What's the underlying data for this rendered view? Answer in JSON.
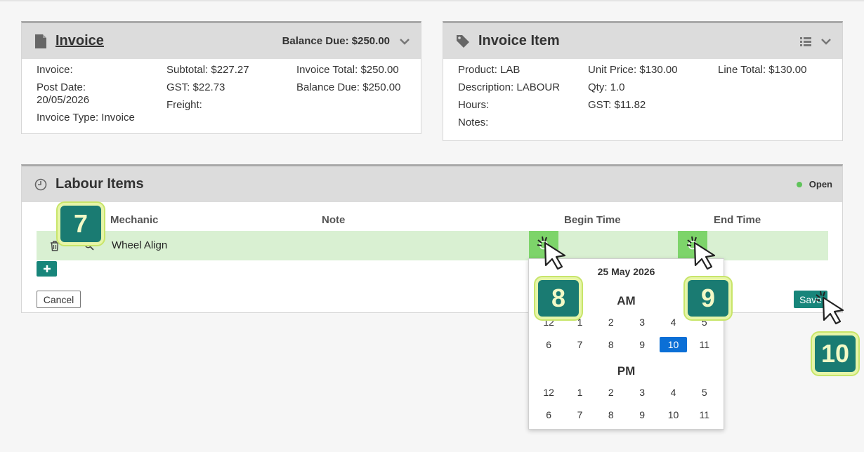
{
  "invoice_panel": {
    "title": "Invoice",
    "balance_due": "Balance Due: $250.00",
    "col1": [
      "Invoice:",
      "Post Date:",
      "20/05/2026",
      "Invoice Type: Invoice"
    ],
    "col2": [
      "Subtotal: $227.27",
      "GST: $22.73",
      "Freight:"
    ],
    "col3": [
      "Invoice Total: $250.00",
      "Balance Due: $250.00"
    ]
  },
  "item_panel": {
    "title": "Invoice Item",
    "col1": [
      "Product: LAB",
      "Description: LABOUR",
      "Hours:",
      "Notes:"
    ],
    "col2": [
      "Unit Price: $130.00",
      "Qty: 1.0",
      "GST: $11.82"
    ],
    "col3": [
      "Line Total: $130.00"
    ]
  },
  "labour_panel": {
    "title": "Labour Items",
    "status": "Open",
    "columns": {
      "mechanic": "Mechanic",
      "note": "Note",
      "begin": "Begin Time",
      "end": "End Time"
    },
    "row": {
      "note": "Wheel Align"
    },
    "cancel_label": "Cancel",
    "save_label": "Save"
  },
  "time_picker": {
    "date": "25 May 2026",
    "am_label": "AM",
    "pm_label": "PM",
    "am_hours": [
      "12",
      "1",
      "2",
      "3",
      "4",
      "5",
      "6",
      "7",
      "8",
      "9",
      "10",
      "11"
    ],
    "pm_hours": [
      "12",
      "1",
      "2",
      "3",
      "4",
      "5",
      "6",
      "7",
      "8",
      "9",
      "10",
      "11"
    ],
    "selected_am_hour": "10"
  },
  "annotations": [
    "7",
    "8",
    "9",
    "10"
  ],
  "colors": {
    "teal": "#17857a",
    "row_green": "#d9f0d2",
    "cell_green": "#7dd46a",
    "selected_blue": "#0b6fd6",
    "status_green": "#5fc35a"
  }
}
